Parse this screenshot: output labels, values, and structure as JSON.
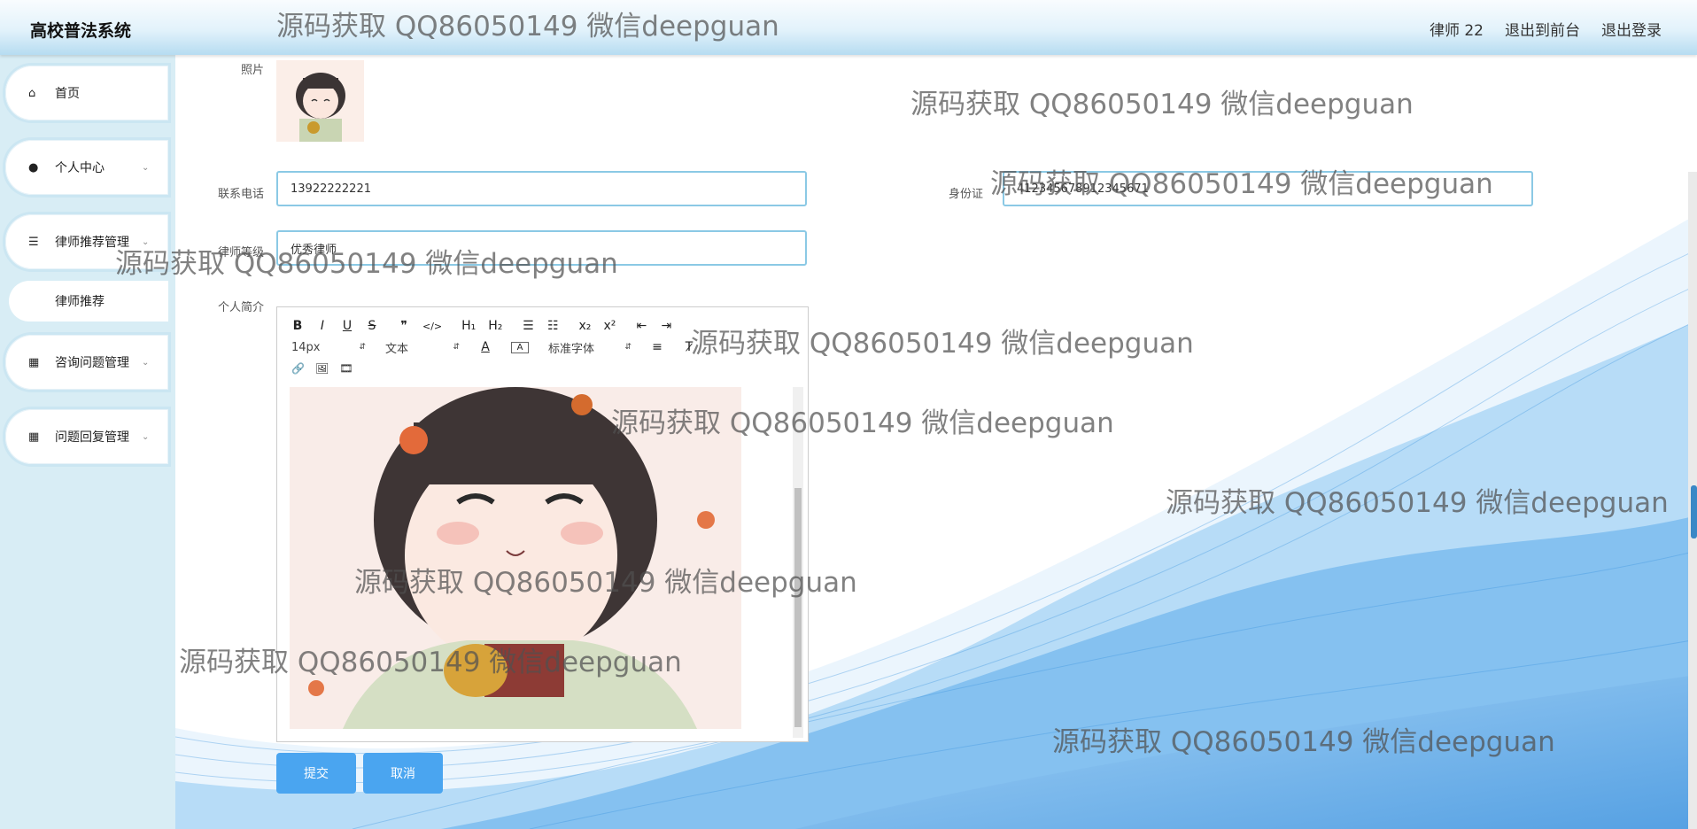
{
  "header": {
    "title": "高校普法系统",
    "user": "律师 22",
    "to_front": "退出到前台",
    "logout": "退出登录"
  },
  "sidebar": {
    "items": [
      {
        "label": "首页",
        "icon": "home-icon"
      },
      {
        "label": "个人中心",
        "icon": "user-icon"
      },
      {
        "label": "律师推荐管理",
        "icon": "sliders-icon"
      },
      {
        "label": "咨询问题管理",
        "icon": "grid-icon"
      },
      {
        "label": "问题回复管理",
        "icon": "grid-icon"
      }
    ],
    "submenu": {
      "label": "律师推荐"
    }
  },
  "form": {
    "photo_label": "照片",
    "phone_label": "联系电话",
    "phone_value": "13922222221",
    "id_label": "身份证",
    "id_value": "412345678912345671",
    "level_label": "律师等级",
    "level_value": "优秀律师",
    "bio_label": "个人简介"
  },
  "editor": {
    "toolbar_row1": [
      "B",
      "I",
      "U",
      "S",
      "❞",
      "</>",
      "H₁",
      "H₂",
      "☰",
      "☷",
      "x₂",
      "x²",
      "⇤",
      "⇥"
    ],
    "font_size": "14px",
    "text_type": "文本",
    "font_family": "标准字体",
    "toolbar_row3": [
      "🔗",
      "🖼",
      "🎞"
    ]
  },
  "buttons": {
    "submit": "提交",
    "cancel": "取消"
  },
  "watermark": "源码获取 QQ86050149 微信deepguan"
}
